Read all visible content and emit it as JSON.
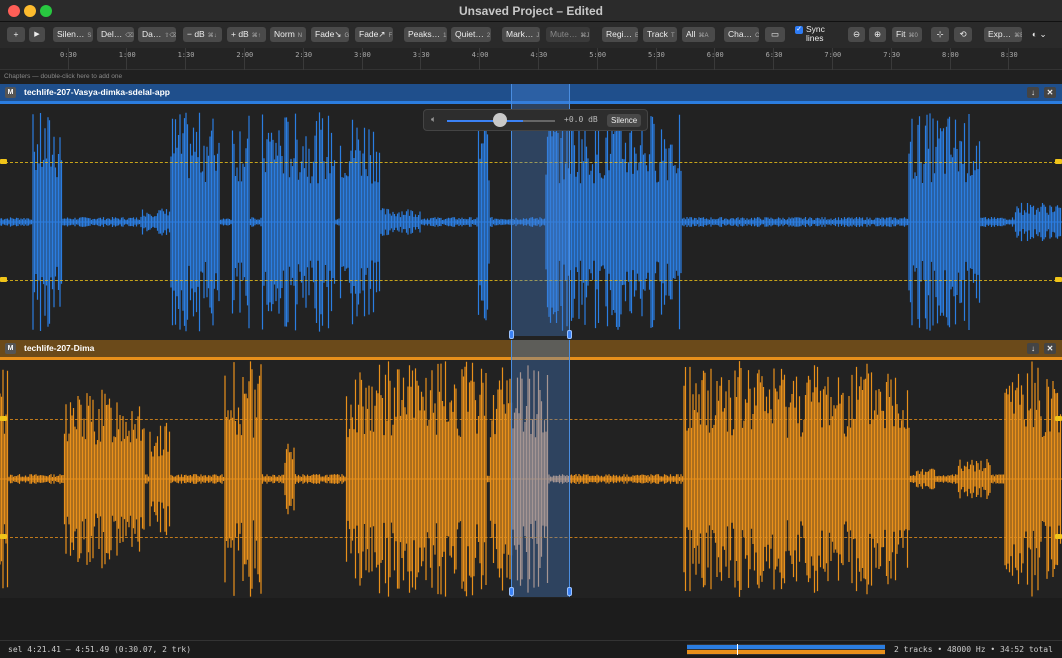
{
  "window": {
    "title": "Unsaved Project – Edited"
  },
  "toolbar": {
    "add_label": "+",
    "play_label": "▶",
    "buttons": [
      {
        "label": "Silen…",
        "key": "S"
      },
      {
        "label": "Del…",
        "key": "⌫"
      },
      {
        "label": "Da…",
        "key": "⇧⌫"
      },
      {
        "label": "− dB",
        "key": "⌘↓"
      },
      {
        "label": "+ dB",
        "key": "⌘↑"
      },
      {
        "label": "Norm",
        "key": "N"
      },
      {
        "label": "Fade↘",
        "key": "G"
      },
      {
        "label": "Fade↗",
        "key": "F"
      },
      {
        "label": "Peaks…",
        "key": "1"
      },
      {
        "label": "Quiet…",
        "key": "2"
      },
      {
        "label": "Mark…",
        "key": "J"
      },
      {
        "label": "Mute…",
        "key": "⌘J"
      },
      {
        "label": "Regi…",
        "key": "E"
      },
      {
        "label": "Track",
        "key": "T"
      },
      {
        "label": "All",
        "key": "⌘A"
      },
      {
        "label": "Cha…",
        "key": "C"
      }
    ],
    "sync_label_1": "Sync",
    "sync_label_2": "lines",
    "fit_label": "Fit",
    "fit_key": "⌘0",
    "export_label": "Exp…",
    "export_key": "⌘E"
  },
  "ruler": {
    "labels": [
      "0:30",
      "1:00",
      "1:30",
      "2:00",
      "2:30",
      "3:00",
      "3:30",
      "4:00",
      "4:30",
      "5:00",
      "5:30",
      "6:00",
      "6:30",
      "7:00",
      "7:30",
      "8:00",
      "8:30"
    ]
  },
  "chapters": {
    "hint": "Chapters — double-click here to add one"
  },
  "tracks": [
    {
      "mute_label": "M",
      "name": "techlife-207-Vasya-dimka-sdelal-app",
      "color": "#2b7de0"
    },
    {
      "mute_label": "M",
      "name": "techlife-207-Dima",
      "color": "#e8901b"
    }
  ],
  "gain_popup": {
    "value": "+0.0 dB",
    "silence_label": "Silence",
    "level": 0.0
  },
  "status": {
    "selection": "sel 4:21.41 — 4:51.49  (0:30.07, 2 trk)",
    "info": "2 tracks • 48000 Hz • 34:52 total"
  }
}
